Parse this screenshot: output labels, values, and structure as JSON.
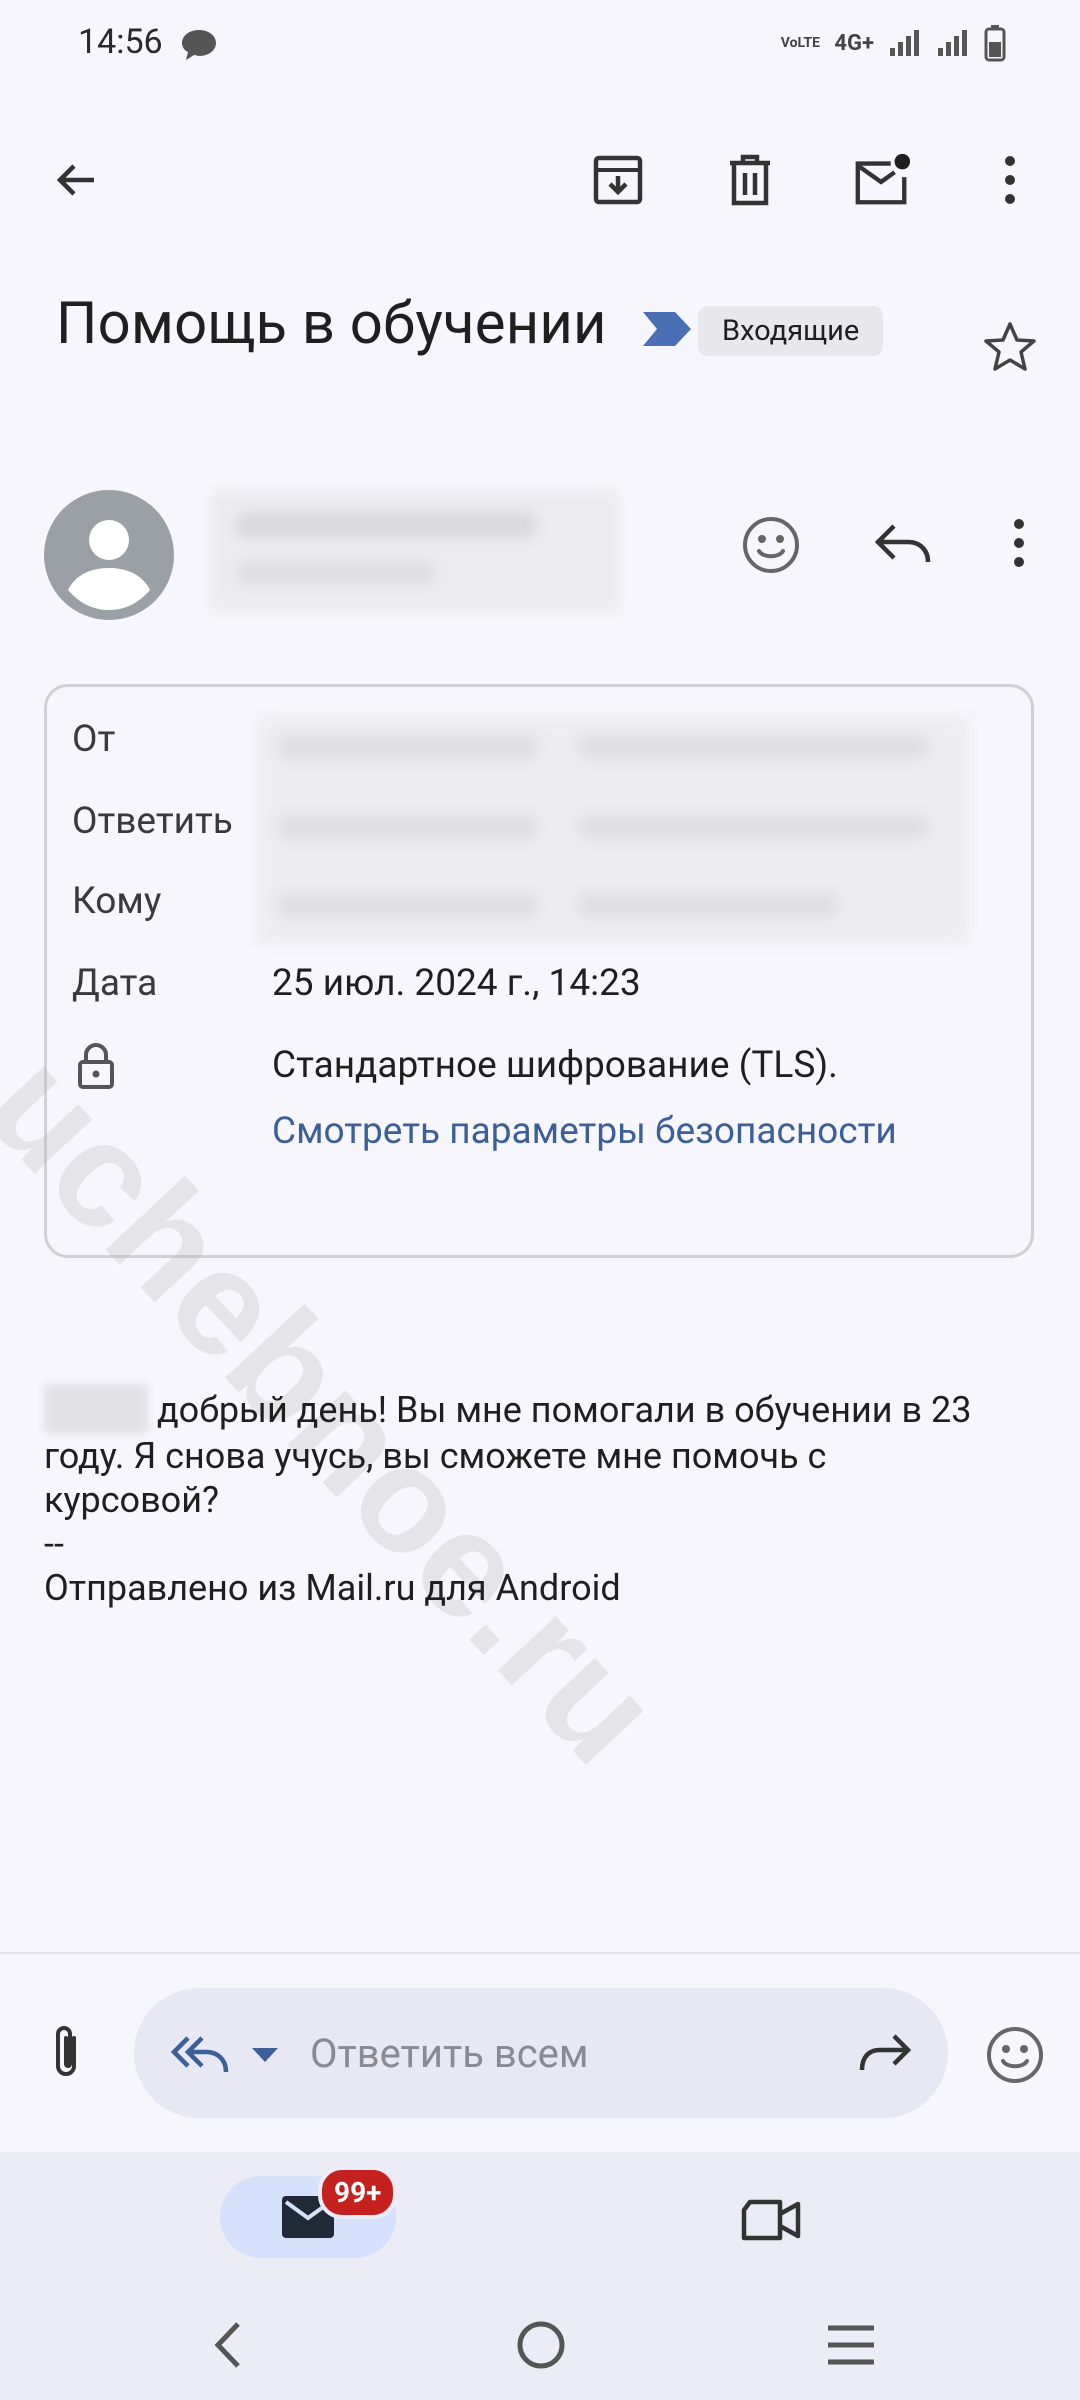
{
  "status_bar": {
    "time": "14:56",
    "network": "4G+",
    "volte": "VoLTE"
  },
  "toolbar": {
    "back": "back-arrow-icon",
    "archive": "archive-icon",
    "delete": "trash-icon",
    "mark_unread": "mark-unread-icon",
    "more": "more-vert-icon"
  },
  "email": {
    "subject": "Помощь в обучении",
    "label": "Входящие",
    "sender_name": "",
    "details": {
      "from_label": "От",
      "reply_to_label": "Ответить",
      "to_label": "Кому",
      "date_label": "Дата",
      "date_value": "25 июл. 2024 г., 14:23",
      "encryption_value": "Стандартное шифрование (TLS).",
      "security_link": "Смотреть параметры безопасности"
    },
    "body_lines": [
      "добрый день! Вы мне помогали в обучении в 23",
      "году. Я снова учусь, вы сможете мне помочь с",
      "курсовой?",
      "--",
      "Отправлено из Mail.ru для Android"
    ]
  },
  "watermark": "uchebnoe.ru",
  "reply_bar": {
    "placeholder": "Ответить всем"
  },
  "bottom_nav": {
    "mail_badge": "99+"
  },
  "colors": {
    "accent": "#3c5f98",
    "badge": "#c5221f",
    "background": "#f7f6fc",
    "importance": "#4a6fb5"
  }
}
